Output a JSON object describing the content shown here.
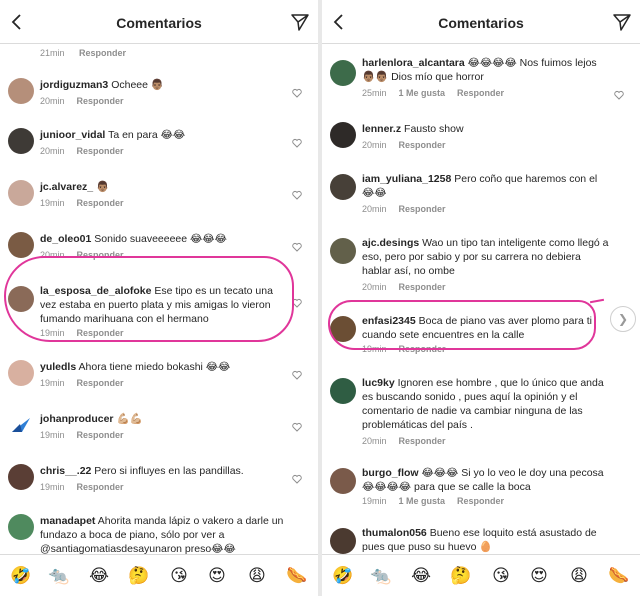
{
  "left": {
    "header": {
      "title": "Comentarios"
    },
    "top_meta": {
      "time": "21min",
      "reply": "Responder"
    },
    "comments": [
      {
        "user": "jordiguzman3",
        "text": "Ocheee 👨🏽",
        "time": "20min",
        "likes": "",
        "reply": "Responder"
      },
      {
        "user": "junioor_vidal",
        "text": "Ta en para 😂😂",
        "time": "20min",
        "likes": "",
        "reply": "Responder"
      },
      {
        "user": "jc.alvarez_",
        "text": "👨🏽",
        "time": "19min",
        "likes": "",
        "reply": "Responder"
      },
      {
        "user": "de_oleo01",
        "text": "Sonido suaveeeeee 😂😂😂",
        "time": "20min",
        "likes": "",
        "reply": "Responder"
      },
      {
        "user": "la_esposa_de_alofoke",
        "text": "Ese tipo es un tecato una vez estaba en puerto plata y mis amigas lo vieron fumando marihuana con el hermano",
        "time": "19min",
        "likes": "",
        "reply": "Responder"
      },
      {
        "user": "yuledls",
        "text": "Ahora tiene miedo bokashi 😂😂",
        "time": "19min",
        "likes": "",
        "reply": "Responder"
      },
      {
        "user": "johanproducer",
        "text": "💪🏼💪🏼",
        "time": "19min",
        "likes": "",
        "reply": "Responder"
      },
      {
        "user": "chris__.22",
        "text": "Pero si influyes en las pandillas.",
        "time": "19min",
        "likes": "",
        "reply": "Responder"
      },
      {
        "user": "manadapet",
        "text": "Ahorita manda lápiz o vakero a darle un fundazo a boca de piano, sólo por ver a @santiagomatiasdesayunaron preso😂😂",
        "time": "",
        "likes": "",
        "reply": ""
      }
    ],
    "emojis": [
      "🤣",
      "🐀",
      "😂",
      "🤔",
      "😘",
      "😍",
      "😩",
      "🌭"
    ]
  },
  "right": {
    "header": {
      "title": "Comentarios"
    },
    "comments": [
      {
        "user": "harlenlora_alcantara",
        "text": "😂😂😂😂 Nos fuimos lejos 👨🏽👨🏽 Dios mío que horror",
        "time": "25min",
        "likes": "1 Me gusta",
        "reply": "Responder"
      },
      {
        "user": "lenner.z",
        "text": "Fausto show",
        "time": "20min",
        "likes": "",
        "reply": "Responder"
      },
      {
        "user": "iam_yuliana_1258",
        "text": "Pero coño que haremos con el 😂😂",
        "time": "20min",
        "likes": "",
        "reply": "Responder"
      },
      {
        "user": "ajc.desings",
        "text": "Wao un tipo tan inteligente como llegó a eso, pero por sabio y por su carrera no debiera hablar así, no ombe",
        "time": "20min",
        "likes": "",
        "reply": "Responder"
      },
      {
        "user": "enfasi2345",
        "text": "Boca de piano vas aver plomo para ti cuando sete encuentres en la calle",
        "time": "19min",
        "likes": "",
        "reply": "Responder"
      },
      {
        "user": "luc9ky",
        "text": "Ignoren ese hombre , que lo único que anda es buscando sonido , pues aquí la opinión y el comentario de nadie va cambiar ninguna de las problemáticas del país .",
        "time": "20min",
        "likes": "",
        "reply": "Responder"
      },
      {
        "user": "burgo_flow",
        "text": "😂😂😂 Si yo lo veo le doy una pecosa 😂😂😂😂 para que se calle la boca",
        "time": "19min",
        "likes": "1 Me gusta",
        "reply": "Responder"
      },
      {
        "user": "thumalon056",
        "text": "Bueno ese loquito está asustado de pues que puso su huevo 🥚",
        "time": "",
        "likes": "",
        "reply": ""
      }
    ],
    "emojis": [
      "🤣",
      "🐀",
      "😂",
      "🤔",
      "😘",
      "😍",
      "😩",
      "🌭"
    ]
  },
  "colors": {
    "highlight": "#e0369a",
    "meta": "#8e8e8e",
    "text": "#262626"
  },
  "icons": {
    "back": "chevron-left-icon",
    "send": "send-icon",
    "like": "heart-icon"
  }
}
